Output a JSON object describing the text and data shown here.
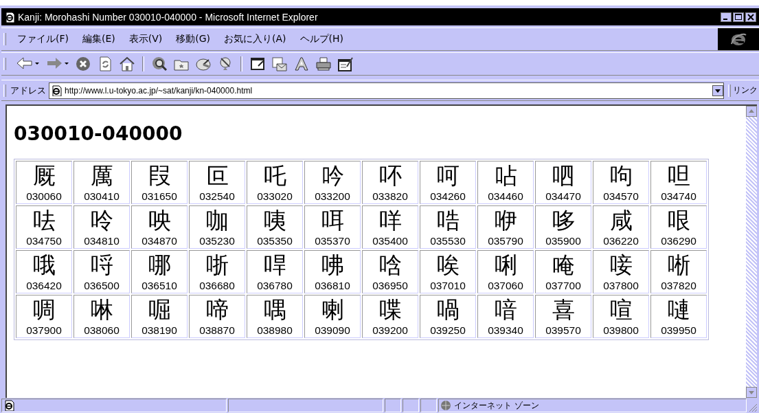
{
  "window": {
    "title": "Kanji: Morohashi Number 030010-040000 - Microsoft Internet Explorer"
  },
  "menu": [
    "ファイル(F)",
    "編集(E)",
    "表示(V)",
    "移動(G)",
    "お気に入り(A)",
    "ヘルプ(H)"
  ],
  "address": {
    "label": "アドレス",
    "value": "http://www.l.u-tokyo.ac.jp/~sat/kanji/kn-040000.html",
    "links": "リンク"
  },
  "page": {
    "heading": "030010-040000",
    "rows": [
      [
        {
          "kanji": "厩",
          "number": "030060"
        },
        {
          "kanji": "厲",
          "number": "030410"
        },
        {
          "kanji": "叚",
          "number": "031650"
        },
        {
          "kanji": "叵",
          "number": "032540"
        },
        {
          "kanji": "吒",
          "number": "033020"
        },
        {
          "kanji": "吟",
          "number": "033200"
        },
        {
          "kanji": "吥",
          "number": "033820"
        },
        {
          "kanji": "呵",
          "number": "034260"
        },
        {
          "kanji": "呫",
          "number": "034460"
        },
        {
          "kanji": "呬",
          "number": "034470"
        },
        {
          "kanji": "呴",
          "number": "034570"
        },
        {
          "kanji": "呾",
          "number": "034740"
        }
      ],
      [
        {
          "kanji": "呿",
          "number": "034750"
        },
        {
          "kanji": "呤",
          "number": "034810"
        },
        {
          "kanji": "咉",
          "number": "034870"
        },
        {
          "kanji": "咖",
          "number": "035230"
        },
        {
          "kanji": "咦",
          "number": "035350"
        },
        {
          "kanji": "咡",
          "number": "035370"
        },
        {
          "kanji": "咩",
          "number": "035400"
        },
        {
          "kanji": "哠",
          "number": "035530"
        },
        {
          "kanji": "咿",
          "number": "035790"
        },
        {
          "kanji": "哆",
          "number": "035900"
        },
        {
          "kanji": "咸",
          "number": "036220"
        },
        {
          "kanji": "哏",
          "number": "036290"
        }
      ],
      [
        {
          "kanji": "哦",
          "number": "036420"
        },
        {
          "kanji": "哷",
          "number": "036500"
        },
        {
          "kanji": "哪",
          "number": "036510"
        },
        {
          "kanji": "哳",
          "number": "036680"
        },
        {
          "kanji": "哻",
          "number": "036780"
        },
        {
          "kanji": "咈",
          "number": "036810"
        },
        {
          "kanji": "唅",
          "number": "036950"
        },
        {
          "kanji": "唉",
          "number": "037010"
        },
        {
          "kanji": "唎",
          "number": "037060"
        },
        {
          "kanji": "唵",
          "number": "037700"
        },
        {
          "kanji": "唼",
          "number": "037800"
        },
        {
          "kanji": "唽",
          "number": "037820"
        }
      ],
      [
        {
          "kanji": "啁",
          "number": "037900"
        },
        {
          "kanji": "啉",
          "number": "038060"
        },
        {
          "kanji": "啒",
          "number": "038190"
        },
        {
          "kanji": "啼",
          "number": "038870"
        },
        {
          "kanji": "喁",
          "number": "038980"
        },
        {
          "kanji": "喇",
          "number": "039090"
        },
        {
          "kanji": "喋",
          "number": "039200"
        },
        {
          "kanji": "喎",
          "number": "039250"
        },
        {
          "kanji": "喑",
          "number": "039340"
        },
        {
          "kanji": "喜",
          "number": "039570"
        },
        {
          "kanji": "喧",
          "number": "039800"
        },
        {
          "kanji": "嗹",
          "number": "039950"
        }
      ]
    ]
  },
  "status_bar": {
    "zone": "インターネット ゾーン"
  }
}
